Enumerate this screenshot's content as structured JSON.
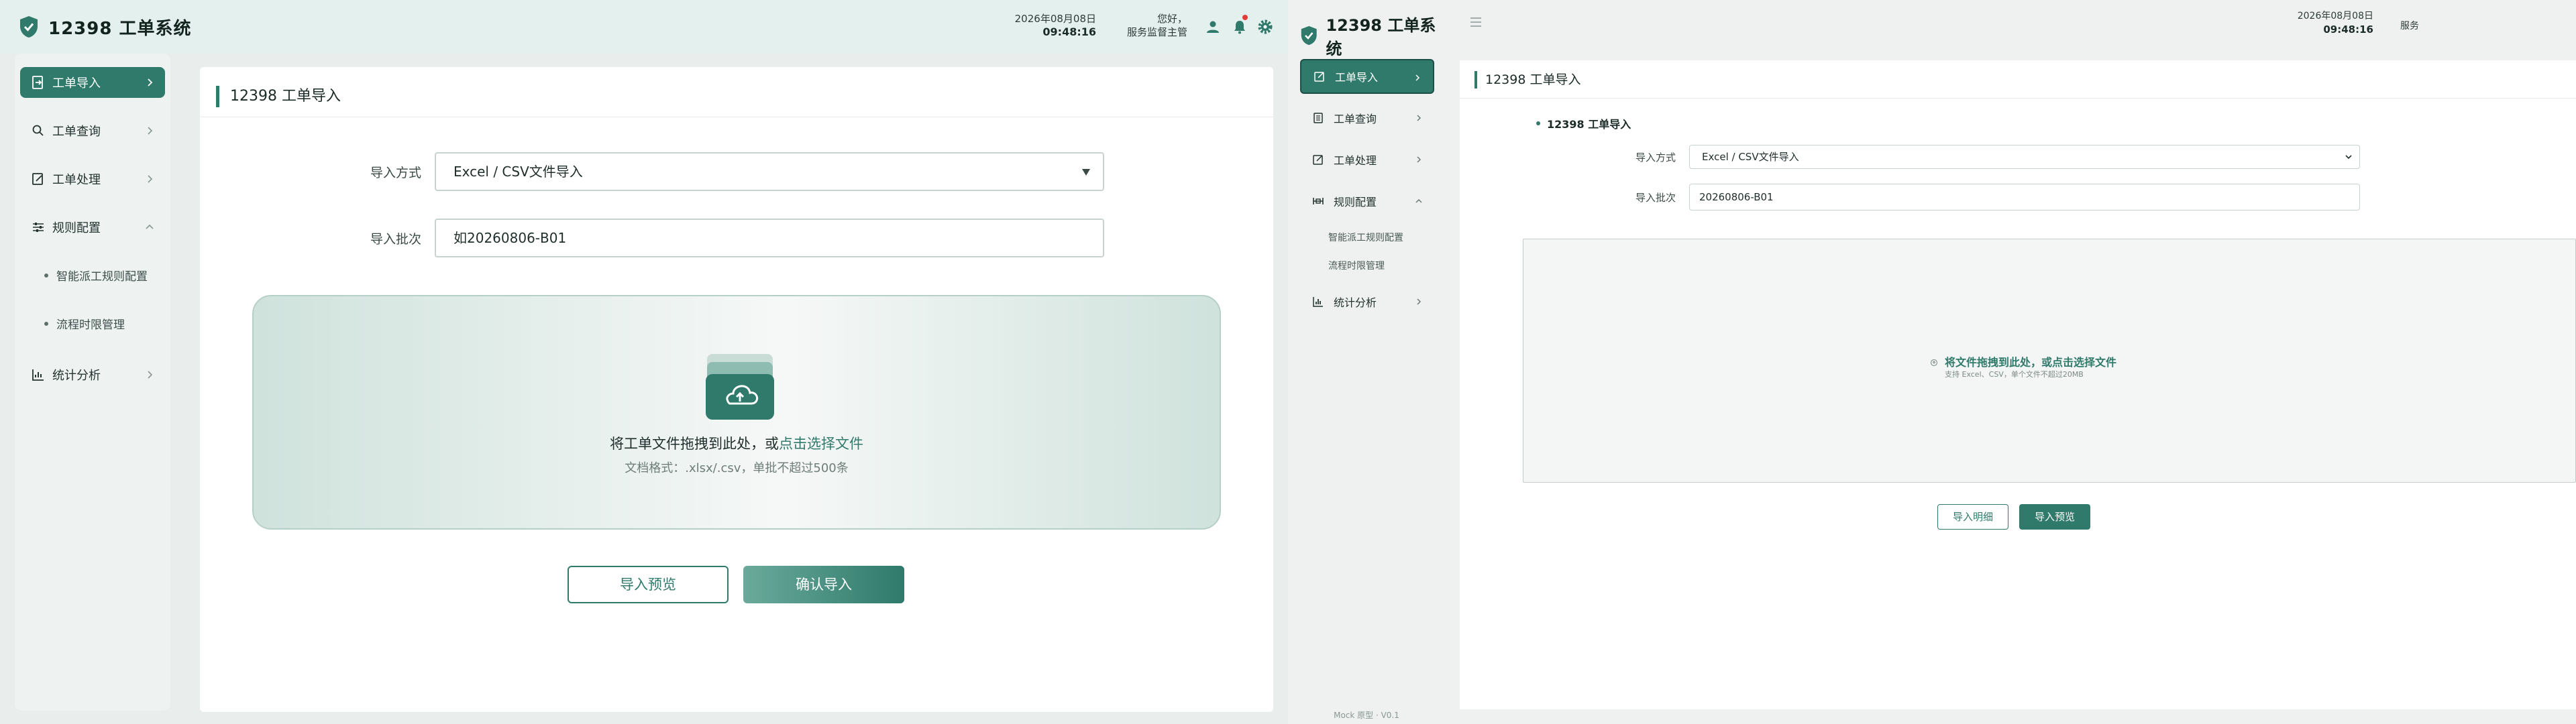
{
  "left": {
    "brand": {
      "title": "12398 工单系统"
    },
    "header": {
      "date": "2026年08月08日",
      "time": "09:48:16",
      "greeting": "您好，",
      "role": "服务监督主管"
    },
    "sidebar": {
      "items": [
        {
          "label": "工单导入",
          "icon": "file-import-icon",
          "active": true
        },
        {
          "label": "工单查询",
          "icon": "search-list-icon"
        },
        {
          "label": "工单处理",
          "icon": "edit-document-icon"
        },
        {
          "label": "规则配置",
          "icon": "sliders-icon",
          "expanded": true
        },
        {
          "label": "统计分析",
          "icon": "chart-icon"
        }
      ],
      "subitems": [
        "智能派工规则配置",
        "流程时限管理"
      ]
    },
    "card": {
      "title": "12398 工单导入",
      "import_method_label": "导入方式",
      "import_method_value": "Excel / CSV文件导入",
      "batch_label": "导入批次",
      "batch_value": "如20260806-B01",
      "drop_text": "将工单文件拖拽到此处，或",
      "drop_link": "点击选择文件",
      "drop_hint": "文档格式：.xlsx/.csv，单批不超过500条",
      "preview_button": "导入预览",
      "confirm_button": "确认导入"
    }
  },
  "right": {
    "brand": {
      "title": "12398 工单系统"
    },
    "header": {
      "date": "2026年08月08日",
      "time": "09:48:16",
      "greeting": "服务"
    },
    "sidebar": {
      "items": [
        {
          "label": "工单导入",
          "active": true
        },
        {
          "label": "工单查询"
        },
        {
          "label": "工单处理"
        },
        {
          "label": "规则配置",
          "expanded": true
        },
        {
          "label": "统计分析"
        }
      ],
      "subitems": [
        "智能派工规则配置",
        "流程时限管理"
      ],
      "footer": "Mock 原型 · V0.1"
    },
    "card": {
      "title": "12398 工单导入",
      "section": "12398 工单导入",
      "import_method_label": "导入方式",
      "import_method_value": "Excel / CSV文件导入",
      "batch_label": "导入批次",
      "batch_value": "20260806-B01",
      "drop_text": "将文件拖拽到此处，或点击选择文件",
      "drop_hint": "支持 Excel、CSV，单个文件不超过20MB",
      "detail_button": "导入明细",
      "preview_button": "导入预览"
    }
  },
  "colors": {
    "accent": "#2f7a6b",
    "header_bg": "#e4f0ed",
    "page_bg": "#e9eeed",
    "alert": "#e23b3b"
  }
}
